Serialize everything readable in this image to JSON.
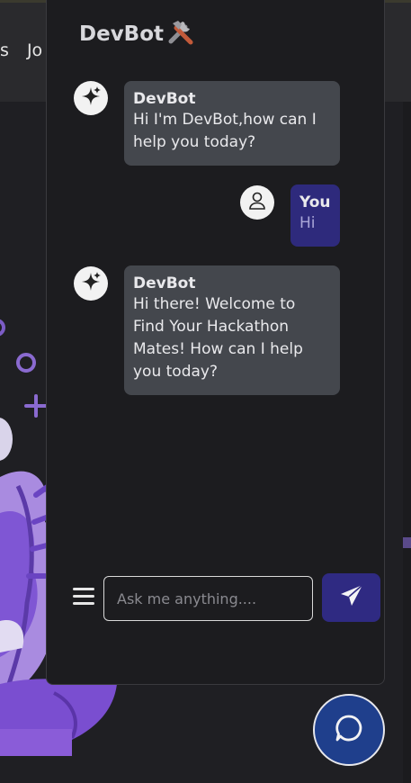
{
  "background": {
    "nav_text": [
      "s",
      "Jo"
    ]
  },
  "chat": {
    "title": "DevBot",
    "title_icon": "tools-icon",
    "messages": [
      {
        "sender": "DevBot",
        "text": "Hi I'm DevBot,how can I help you today?",
        "role": "bot"
      },
      {
        "sender": "You",
        "text": "Hi",
        "role": "user"
      },
      {
        "sender": "DevBot",
        "text": "Hi there! Welcome to Find Your Hackathon Mates! How can I help you today?",
        "role": "bot"
      }
    ],
    "input": {
      "placeholder": "Ask me anything....",
      "value": ""
    }
  },
  "colors": {
    "user_bubble": "#2e2a7c",
    "bot_bubble": "#44474d",
    "send_button": "#2f2a82",
    "fab": "#1f3f8c"
  }
}
